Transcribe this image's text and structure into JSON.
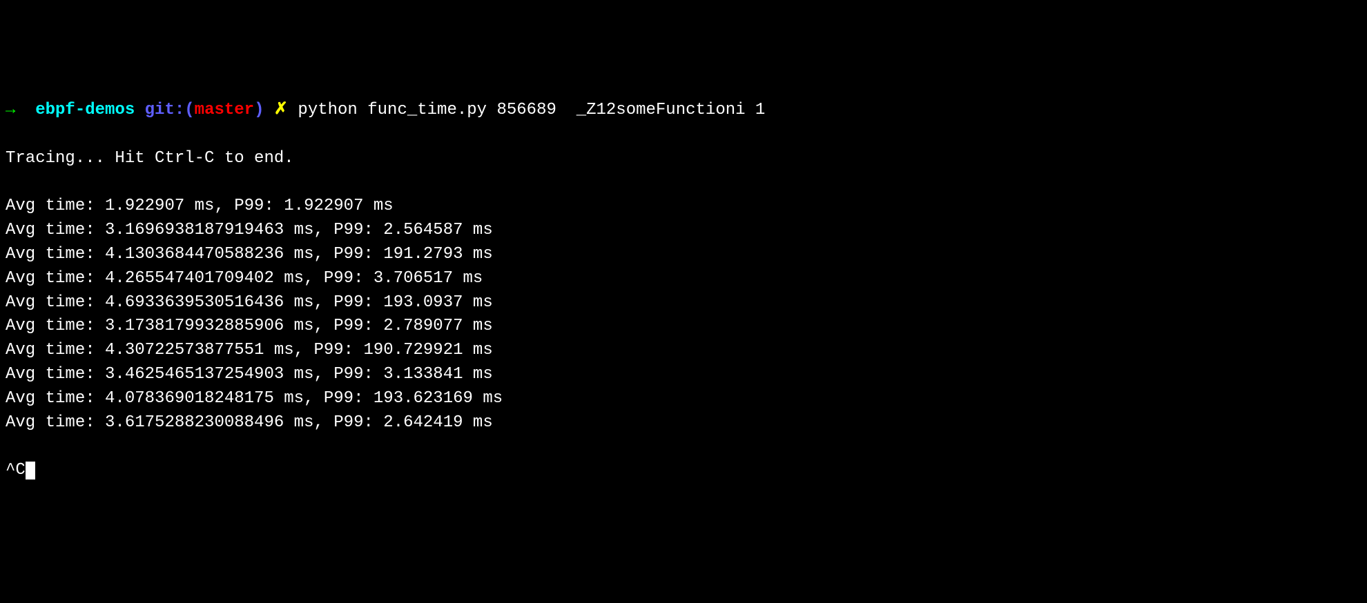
{
  "prompt": {
    "arrow": "→",
    "directory": "ebpf-demos",
    "git_prefix": "git:(",
    "branch": "master",
    "git_suffix": ")",
    "dirty_mark": "✗",
    "command": "python func_time.py 856689  _Z12someFunctioni 1"
  },
  "status_line": "Tracing... Hit Ctrl-C to end.",
  "rows": [
    {
      "avg": "1.922907",
      "p99": "1.922907"
    },
    {
      "avg": "3.1696938187919463",
      "p99": "2.564587"
    },
    {
      "avg": "4.1303684470588236",
      "p99": "191.2793"
    },
    {
      "avg": "4.265547401709402",
      "p99": "3.706517"
    },
    {
      "avg": "4.6933639530516436",
      "p99": "193.0937"
    },
    {
      "avg": "3.1738179932885906",
      "p99": "2.789077"
    },
    {
      "avg": "4.30722573877551",
      "p99": "190.729921"
    },
    {
      "avg": "3.4625465137254903",
      "p99": "3.133841"
    },
    {
      "avg": "4.078369018248175",
      "p99": "193.623169"
    },
    {
      "avg": "3.6175288230088496",
      "p99": "2.642419"
    }
  ],
  "interrupt": "^C",
  "cursor_char": "▋",
  "colors": {
    "arrow": "#00ff00",
    "directory": "#00ffff",
    "git": "#5f5fff",
    "branch": "#ff0000",
    "dirty": "#ffff00",
    "text": "#ffffff",
    "background": "#000000"
  }
}
